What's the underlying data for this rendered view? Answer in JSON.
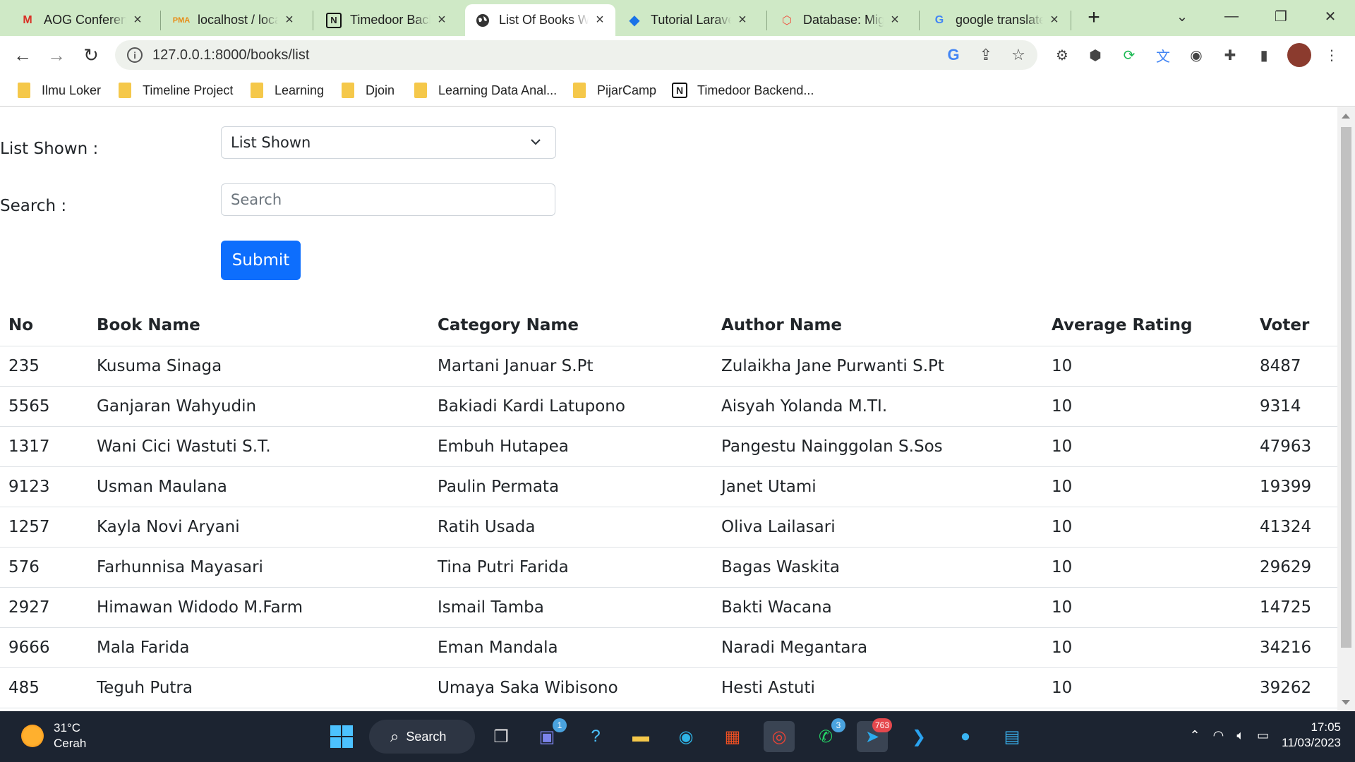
{
  "browser": {
    "tabs": [
      {
        "title": "AOG Conference",
        "icon": "gmail-icon"
      },
      {
        "title": "localhost / localhost",
        "icon": "phpmyadmin-icon"
      },
      {
        "title": "Timedoor Backend",
        "icon": "notion-icon"
      },
      {
        "title": "List Of Books Website",
        "icon": "globe-icon",
        "active": true
      },
      {
        "title": "Tutorial Laravel",
        "icon": "code-icon"
      },
      {
        "title": "Database: Migrations",
        "icon": "laravel-icon"
      },
      {
        "title": "google translate",
        "icon": "google-icon"
      }
    ],
    "url": "127.0.0.1:8000/books/list",
    "bookmarks": [
      {
        "label": "Ilmu Loker",
        "icon": "folder-icon"
      },
      {
        "label": "Timeline Project",
        "icon": "folder-icon"
      },
      {
        "label": "Learning",
        "icon": "folder-icon"
      },
      {
        "label": "Djoin",
        "icon": "folder-icon"
      },
      {
        "label": "Learning Data Anal...",
        "icon": "folder-icon"
      },
      {
        "label": "PijarCamp",
        "icon": "folder-icon"
      },
      {
        "label": "Timedoor Backend...",
        "icon": "notion-icon"
      }
    ]
  },
  "form": {
    "list_label": "List Shown :",
    "list_value": "List Shown",
    "search_label": "Search :",
    "search_placeholder": "Search",
    "submit_label": "Submit"
  },
  "table": {
    "headers": [
      "No",
      "Book Name",
      "Category Name",
      "Author Name",
      "Average Rating",
      "Voter"
    ],
    "rows": [
      [
        "235",
        "Kusuma Sinaga",
        "Martani Januar S.Pt",
        "Zulaikha Jane Purwanti S.Pt",
        "10",
        "8487"
      ],
      [
        "5565",
        "Ganjaran Wahyudin",
        "Bakiadi Kardi Latupono",
        "Aisyah Yolanda M.TI.",
        "10",
        "9314"
      ],
      [
        "1317",
        "Wani Cici Wastuti S.T.",
        "Embuh Hutapea",
        "Pangestu Nainggolan S.Sos",
        "10",
        "47963"
      ],
      [
        "9123",
        "Usman Maulana",
        "Paulin Permata",
        "Janet Utami",
        "10",
        "19399"
      ],
      [
        "1257",
        "Kayla Novi Aryani",
        "Ratih Usada",
        "Oliva Lailasari",
        "10",
        "41324"
      ],
      [
        "576",
        "Farhunnisa Mayasari",
        "Tina Putri Farida",
        "Bagas Waskita",
        "10",
        "29629"
      ],
      [
        "2927",
        "Himawan Widodo M.Farm",
        "Ismail Tamba",
        "Bakti Wacana",
        "10",
        "14725"
      ],
      [
        "9666",
        "Mala Farida",
        "Eman Mandala",
        "Naradi Megantara",
        "10",
        "34216"
      ],
      [
        "485",
        "Teguh Putra",
        "Umaya Saka Wibisono",
        "Hesti Astuti",
        "10",
        "39262"
      ]
    ]
  },
  "taskbar": {
    "weather_temp": "31°C",
    "weather_desc": "Cerah",
    "search_label": "Search",
    "chat_badge": "1",
    "whatsapp_badge": "3",
    "telegram_badge": "763",
    "time": "17:05",
    "date": "11/03/2023"
  }
}
